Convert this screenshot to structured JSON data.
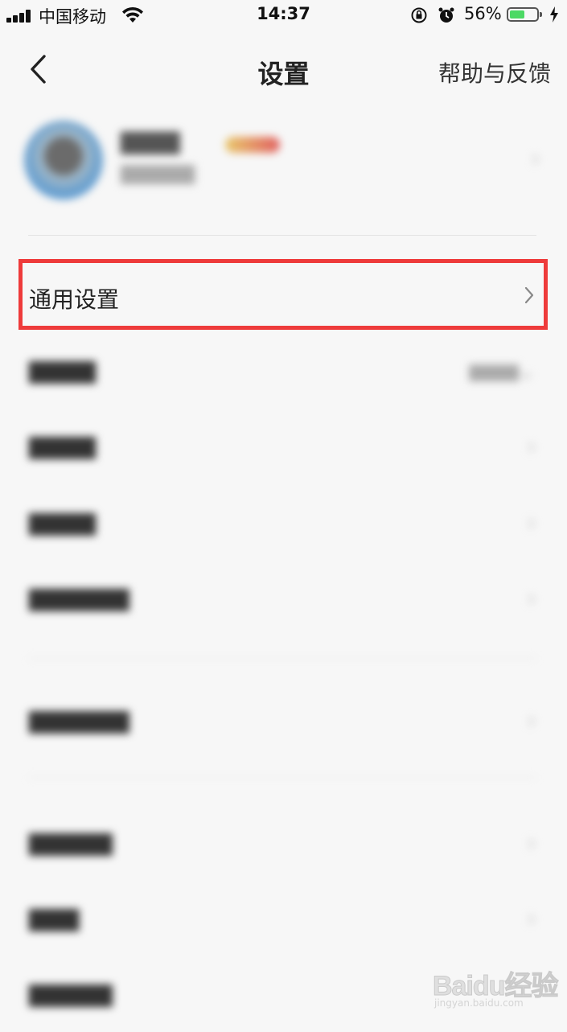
{
  "status_bar": {
    "carrier": "中国移动",
    "time": "14:37",
    "battery_percent": "56%",
    "battery_level": 0.56,
    "icons": [
      "signal-icon",
      "wifi-icon",
      "orientation-lock-icon",
      "alarm-icon",
      "battery-icon",
      "charging-bolt-icon"
    ]
  },
  "nav": {
    "back_icon": "chevron-left-icon",
    "title": "设置",
    "help": "帮助与反馈"
  },
  "profile": {
    "nickname": "",
    "subtitle": ""
  },
  "settings": {
    "general_label": "通用设置",
    "highlight_color": "#ee3b3b"
  },
  "watermark": {
    "logo": "Baidu经验",
    "url": "jingyan.baidu.com"
  }
}
